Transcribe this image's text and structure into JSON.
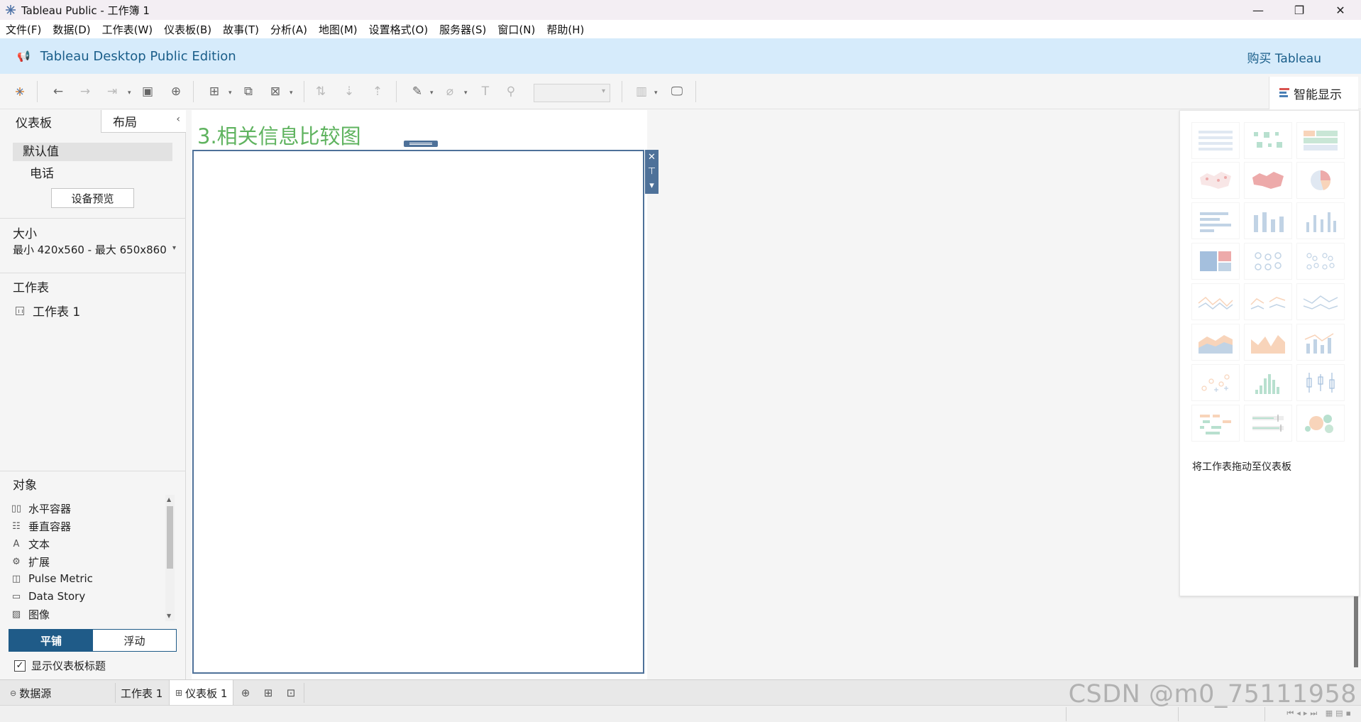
{
  "window": {
    "title": "Tableau Public - 工作簿 1",
    "app_icon": "tableau-logo-icon",
    "controls": [
      "minimize-icon",
      "restore-icon",
      "close-icon"
    ]
  },
  "menubar": {
    "items": [
      "文件(F)",
      "数据(D)",
      "工作表(W)",
      "仪表板(B)",
      "故事(T)",
      "分析(A)",
      "地图(M)",
      "设置格式(O)",
      "服务器(S)",
      "窗口(N)",
      "帮助(H)"
    ]
  },
  "banner": {
    "edition": "Tableau Desktop Public Edition",
    "buy_link": "购买 Tableau",
    "background": "#d6ebfb",
    "text_color": "#1a5e8a"
  },
  "toolbar": {
    "smart_show_label": "智能显示",
    "icons": [
      "tableau-logo-icon",
      "undo-icon",
      "redo-icon",
      "replay-icon",
      "save-icon",
      "new-datasource-icon",
      "new-worksheet-icon",
      "duplicate-icon",
      "clear-icon",
      "swap-icon",
      "sort-ascending-icon",
      "sort-descending-icon",
      "highlight-icon",
      "group-icon",
      "label-icon",
      "pin-icon",
      "fit-select",
      "show-cards-icon",
      "presentation-icon"
    ]
  },
  "left_panel": {
    "tabs": {
      "dashboard": "仪表板",
      "layout": "布局"
    },
    "device": {
      "default": "默认值",
      "phone": "电话",
      "preview_button": "设备预览"
    },
    "size": {
      "title": "大小",
      "value": "最小 420x560 - 最大 650x860"
    },
    "sheets": {
      "title": "工作表",
      "items": [
        "工作表 1"
      ]
    },
    "objects": {
      "title": "对象",
      "items": [
        {
          "label": "水平容器",
          "icon": "horizontal-container-icon",
          "glyph": "▯▯"
        },
        {
          "label": "垂直容器",
          "icon": "vertical-container-icon",
          "glyph": "☷"
        },
        {
          "label": "文本",
          "icon": "text-icon",
          "glyph": "A"
        },
        {
          "label": "扩展",
          "icon": "extension-icon",
          "glyph": "⚙"
        },
        {
          "label": "Pulse Metric",
          "icon": "pulse-metric-icon",
          "glyph": "◫"
        },
        {
          "label": "Data Story",
          "icon": "data-story-icon",
          "glyph": "▭"
        },
        {
          "label": "图像",
          "icon": "image-icon",
          "glyph": "▨"
        }
      ]
    },
    "layout_mode": {
      "tiled": "平铺",
      "floating": "浮动",
      "selected": "平铺",
      "accent": "#1f5b88"
    },
    "show_dashboard_title": {
      "label": "显示仪表板标题",
      "checked": true
    }
  },
  "dashboard": {
    "title": "3.相关信息比较图",
    "title_color": "#5fb35f",
    "container_color": "#4e7199"
  },
  "smart_show": {
    "hint": "将工作表拖动至仪表板",
    "chart_types": [
      "text-table",
      "heat-map",
      "highlight-table",
      "symbol-map",
      "filled-map",
      "pie-chart",
      "horizontal-bars",
      "stacked-bars",
      "side-by-side-bars",
      "treemap",
      "circle-views",
      "side-by-side-circles",
      "continuous-lines",
      "discrete-lines",
      "dual-lines",
      "area-continuous",
      "area-discrete",
      "dual-combination",
      "scatter-plot",
      "histogram",
      "box-and-whisker",
      "gantt-chart",
      "bullet-graph",
      "packed-bubbles"
    ]
  },
  "bottom_tabs": {
    "datasource": "数据源",
    "sheets": [
      "工作表 1"
    ],
    "active_dashboard": "仪表板 1",
    "new_icons": [
      "new-worksheet-icon",
      "new-dashboard-icon",
      "new-story-icon"
    ]
  },
  "watermark": "CSDN @m0_75111958"
}
